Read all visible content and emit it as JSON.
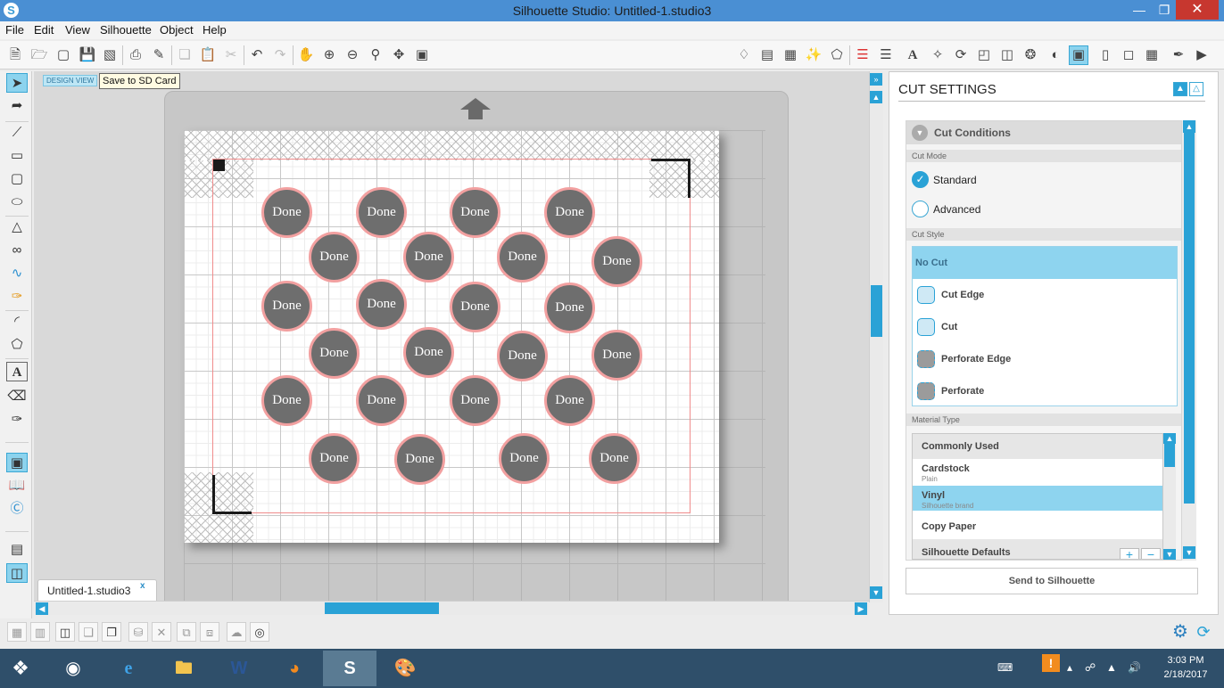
{
  "window": {
    "title": "Silhouette Studio: Untitled-1.studio3",
    "minimize": "—",
    "maximize": "❐",
    "close": "✕"
  },
  "menu": [
    "File",
    "Edit",
    "View",
    "Silhouette",
    "Object",
    "Help"
  ],
  "canvas": {
    "design_view_label": "DESIGN VIEW",
    "tooltip": "Save to SD Card",
    "circle_label": "Done",
    "file_tab": "Untitled-1.studio3",
    "file_tab_close": "x"
  },
  "circles": [
    {
      "label": "Done"
    },
    {
      "label": "Done"
    },
    {
      "label": "Done"
    },
    {
      "label": "Done"
    },
    {
      "label": "Done"
    },
    {
      "label": "Done"
    },
    {
      "label": "Done"
    },
    {
      "label": "Done"
    },
    {
      "label": "Done"
    },
    {
      "label": "Done"
    },
    {
      "label": "Done"
    },
    {
      "label": "Done"
    },
    {
      "label": "Done"
    },
    {
      "label": "Done"
    },
    {
      "label": "Done"
    },
    {
      "label": "Done"
    },
    {
      "label": "Done"
    },
    {
      "label": "Done"
    },
    {
      "label": "Done"
    },
    {
      "label": "Done"
    },
    {
      "label": "Done"
    },
    {
      "label": "Done"
    },
    {
      "label": "Done"
    },
    {
      "label": "Done"
    }
  ],
  "panel": {
    "title": "CUT SETTINGS",
    "cut_conditions": "Cut Conditions",
    "cut_mode_label": "Cut Mode",
    "modes": [
      {
        "label": "Standard",
        "selected": true
      },
      {
        "label": "Advanced",
        "selected": false
      }
    ],
    "cut_style_label": "Cut Style",
    "cut_styles": [
      "No Cut",
      "Cut Edge",
      "Cut",
      "Perforate Edge",
      "Perforate"
    ],
    "selected_cut_style": "No Cut",
    "material_type_label": "Material Type",
    "materials": [
      {
        "name": "Commonly Used",
        "sub": "",
        "kind": "header"
      },
      {
        "name": "Cardstock",
        "sub": "Plain",
        "kind": "item"
      },
      {
        "name": "Vinyl",
        "sub": "Silhouette brand",
        "kind": "selected"
      },
      {
        "name": "Copy Paper",
        "sub": "",
        "kind": "item"
      },
      {
        "name": "Silhouette Defaults",
        "sub": "",
        "kind": "header"
      }
    ],
    "add_material": "+",
    "remove_material": "−",
    "send_button": "Send to Silhouette"
  },
  "taskbar": {
    "time": "3:03 PM",
    "date": "2/18/2017"
  },
  "colors": {
    "accent": "#2aa2d6",
    "circle_fill": "#6e6e6e",
    "circle_stroke": "#f2a0a0",
    "cut_border": "#f08c8c",
    "taskbar": "#2f4f6a"
  }
}
